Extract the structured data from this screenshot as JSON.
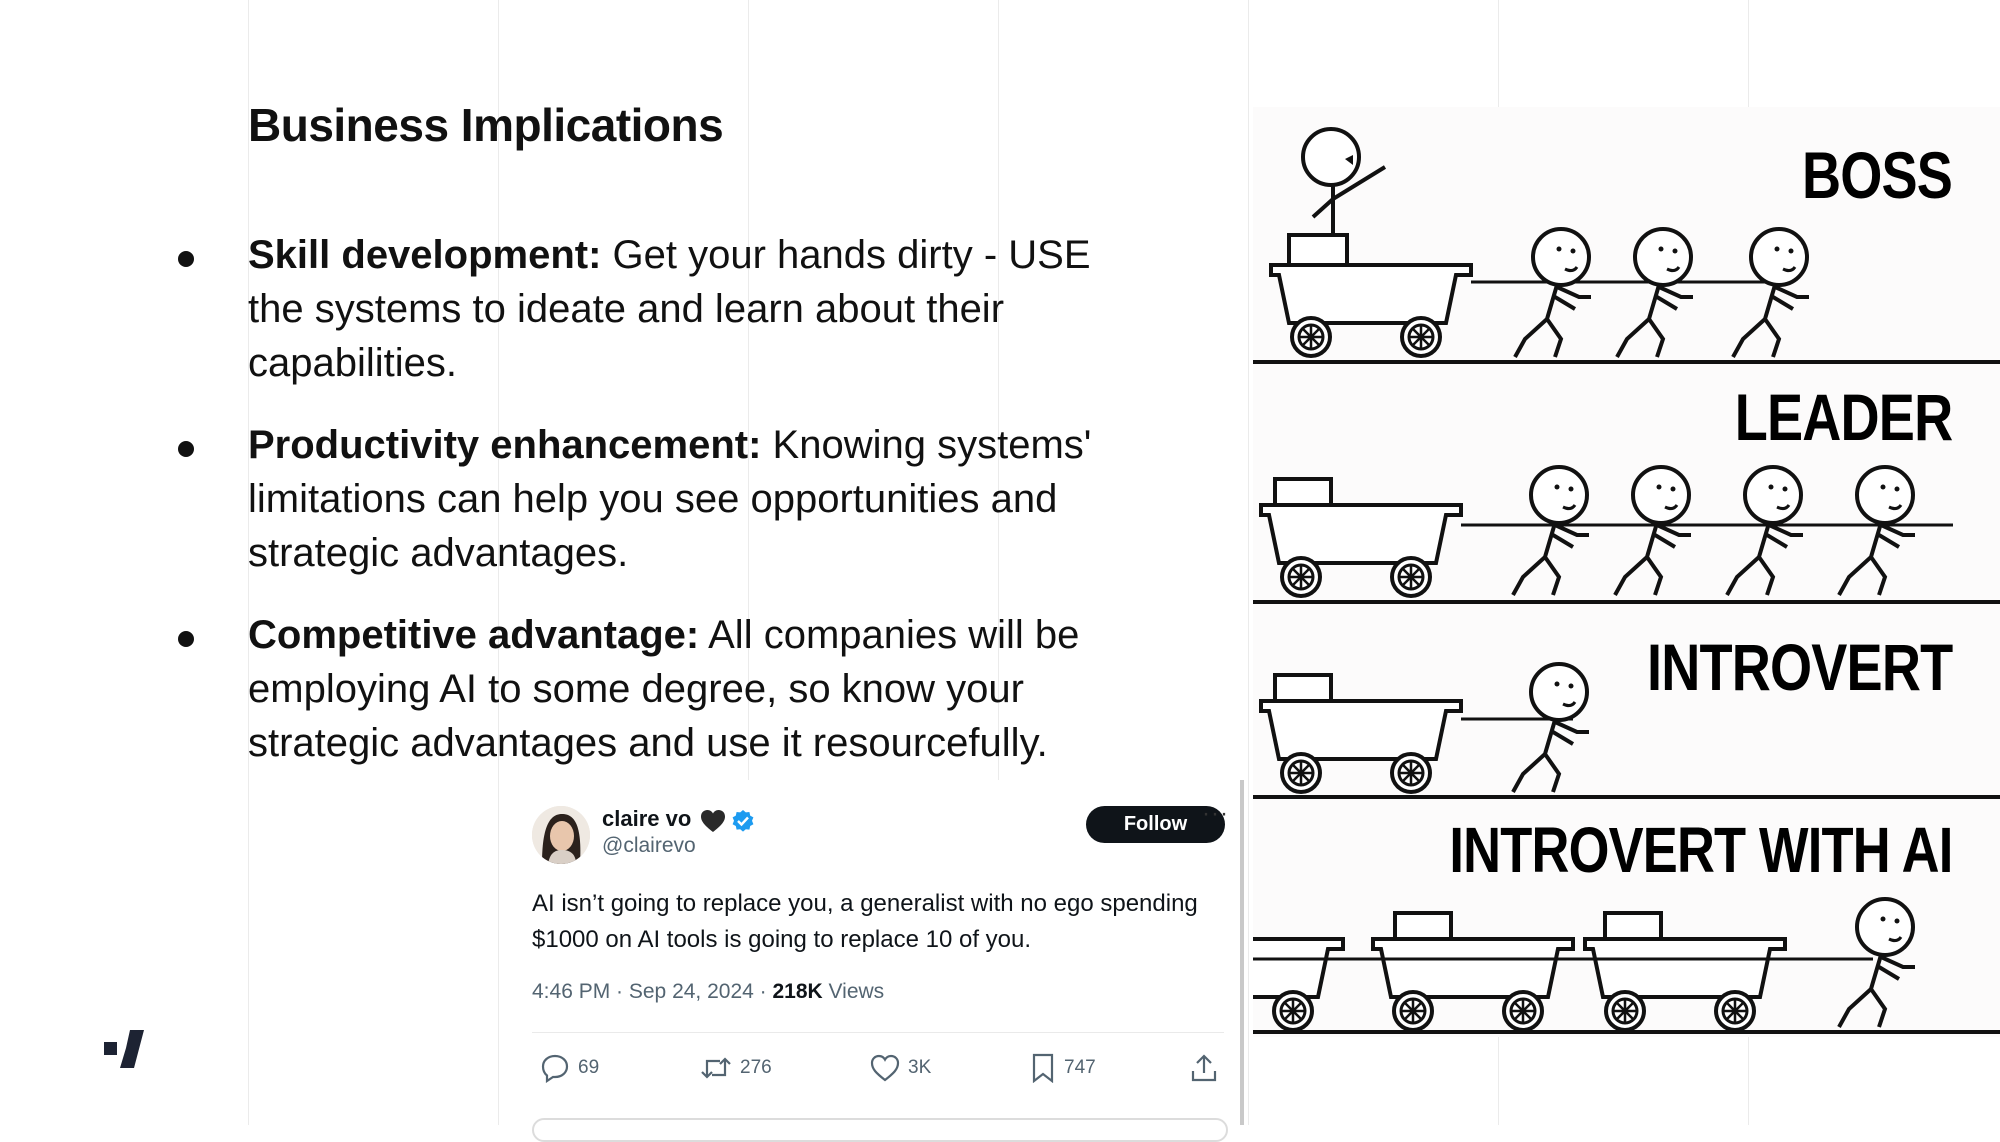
{
  "slide": {
    "title": "Business Implications",
    "bullets": [
      {
        "bold": "Skill development:",
        "text": " Get your hands dirty - USE the systems to ideate and learn about their capabilities."
      },
      {
        "bold": "Productivity enhancement:",
        "text": " Knowing systems' limitations can help you see opportunities and strategic advantages."
      },
      {
        "bold": "Competitive advantage:",
        "text": " All companies will be employing AI to some degree, so know your strategic advantages and use it resourcefully."
      }
    ]
  },
  "tweet": {
    "display_name": "claire vo",
    "handle": "@clairevo",
    "follow_label": "Follow",
    "more_label": "···",
    "text": "AI isn’t going to replace you, a generalist with no ego spending  $1000 on AI tools is going to replace 10 of you.",
    "time": "4:46 PM · Sep 24, 2024 · ",
    "views_count": "218K",
    "views_label": " Views",
    "replies": "69",
    "reposts": "276",
    "likes": "3K",
    "bookmarks": "747",
    "colors": {
      "follow_bg": "#0f1419",
      "verified": "#1d9bf0",
      "secondary_text": "#536471"
    }
  },
  "meme": {
    "panels": [
      "BOSS",
      "LEADER",
      "INTROVERT",
      "INTROVERT WITH AI"
    ]
  },
  "icons": [
    "logo-mark",
    "heart-icon",
    "verified-badge-icon",
    "reply-icon",
    "repost-icon",
    "like-icon",
    "bookmark-icon",
    "share-icon"
  ]
}
